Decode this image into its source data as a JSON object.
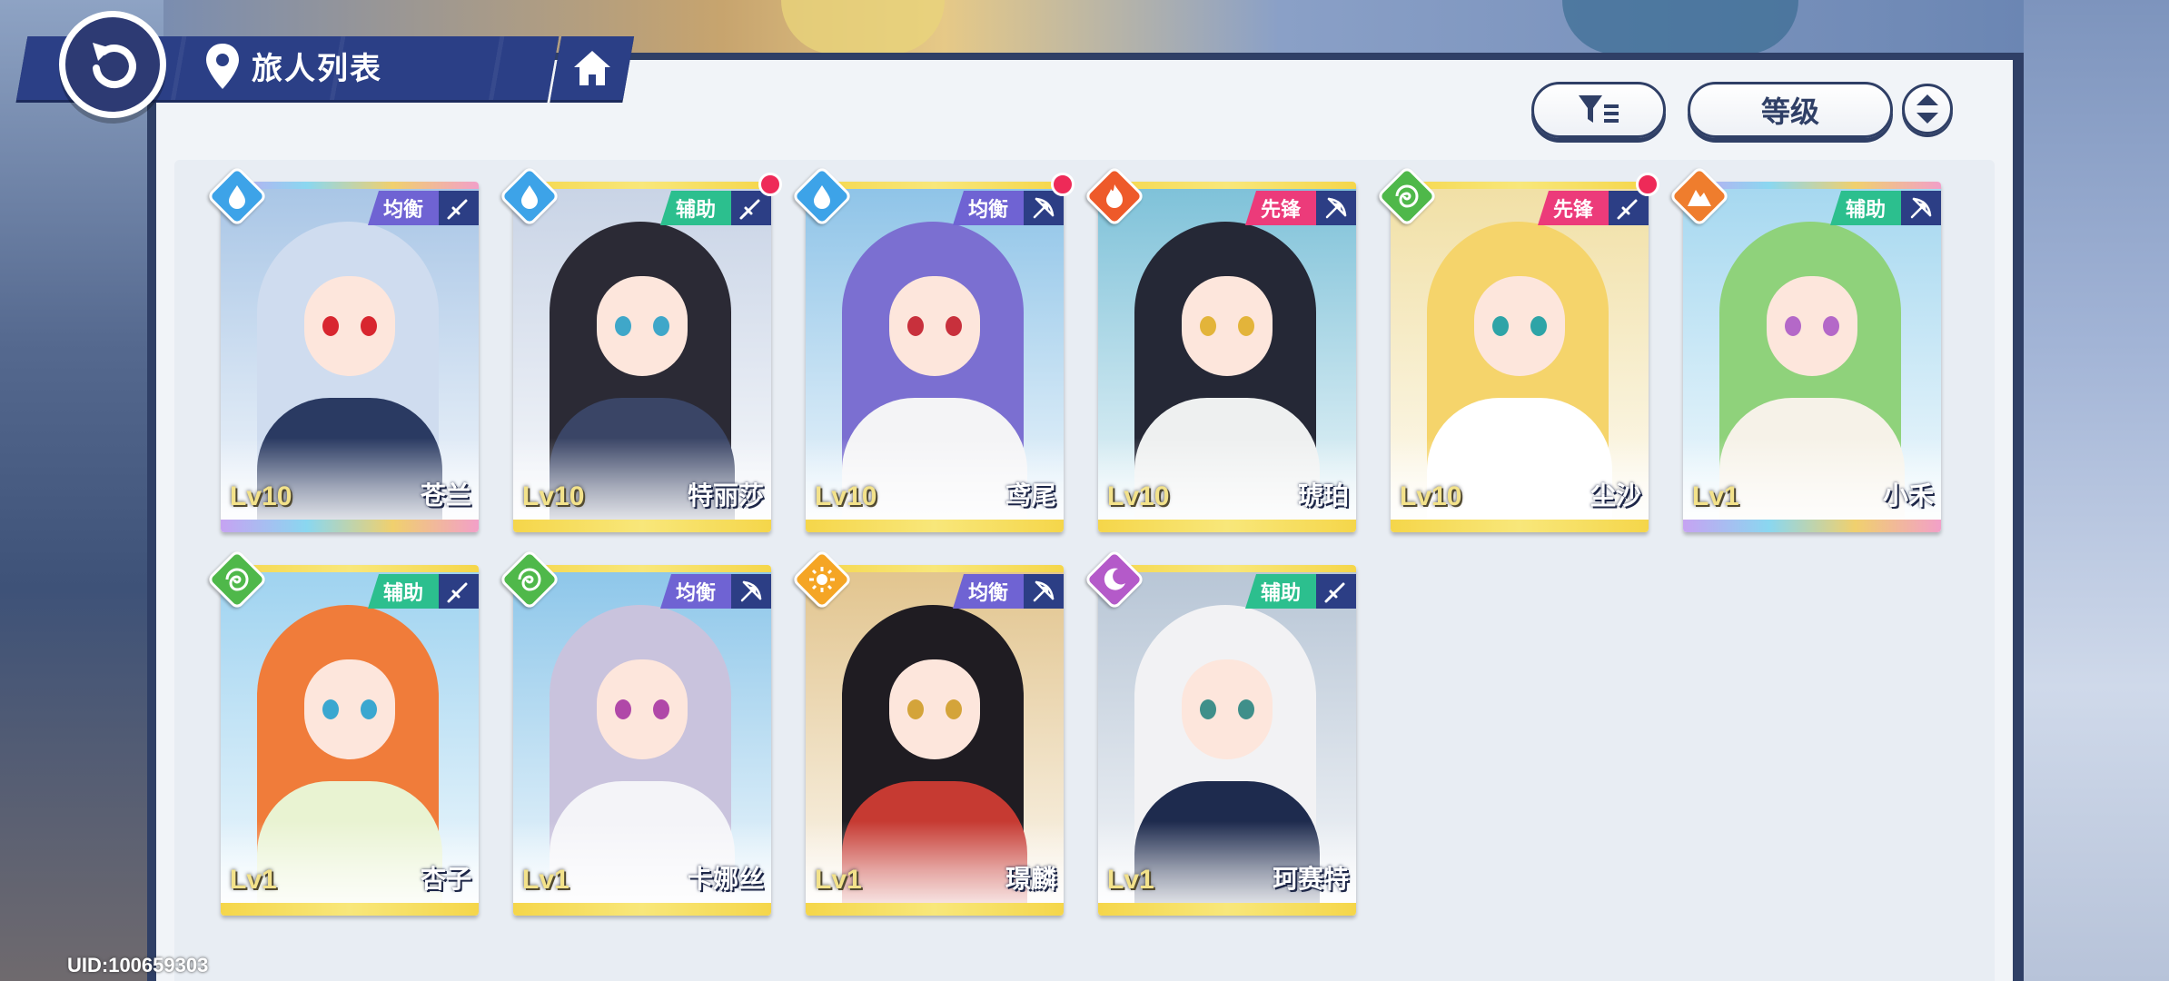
{
  "header": {
    "title": "旅人列表"
  },
  "toolbar": {
    "sort_label": "等级"
  },
  "footer": {
    "uid": "UID:100659303"
  },
  "colors": {
    "panel_border": "#2f3f66",
    "header_blue": "#2b3f86",
    "role_balance": "#6f63d3",
    "role_support": "#2cbf8e",
    "role_vanguard": "#ec3b7a",
    "elem_water": "#3da3e8",
    "elem_fire": "#ee5a2a",
    "elem_wind": "#4fb84a",
    "elem_earth": "#ef7d2d",
    "elem_light": "#f5a524",
    "elem_dark": "#b45ac9",
    "unread_dot": "#ee2a58"
  },
  "characters": [
    {
      "name": "苍兰",
      "level": "Lv10",
      "role": "均衡",
      "element": "water",
      "weapon": "sword",
      "rarity": "rainbow",
      "new": false
    },
    {
      "name": "特丽莎",
      "level": "Lv10",
      "role": "辅助",
      "element": "water",
      "weapon": "sword",
      "rarity": "gold",
      "new": true
    },
    {
      "name": "鸢尾",
      "level": "Lv10",
      "role": "均衡",
      "element": "water",
      "weapon": "bow",
      "rarity": "gold",
      "new": true
    },
    {
      "name": "琥珀",
      "level": "Lv10",
      "role": "先锋",
      "element": "fire",
      "weapon": "bow",
      "rarity": "gold",
      "new": false
    },
    {
      "name": "尘沙",
      "level": "Lv10",
      "role": "先锋",
      "element": "wind",
      "weapon": "sword",
      "rarity": "gold",
      "new": true
    },
    {
      "name": "小禾",
      "level": "Lv1",
      "role": "辅助",
      "element": "earth",
      "weapon": "bow",
      "rarity": "rainbow",
      "new": false
    },
    {
      "name": "杏子",
      "level": "Lv1",
      "role": "辅助",
      "element": "wind",
      "weapon": "sword",
      "rarity": "gold",
      "new": false
    },
    {
      "name": "卡娜丝",
      "level": "Lv1",
      "role": "均衡",
      "element": "wind",
      "weapon": "bow",
      "rarity": "gold",
      "new": false
    },
    {
      "name": "璟麟",
      "level": "Lv1",
      "role": "均衡",
      "element": "light",
      "weapon": "bow",
      "rarity": "gold",
      "new": false
    },
    {
      "name": "珂赛特",
      "level": "Lv1",
      "role": "辅助",
      "element": "dark",
      "weapon": "sword",
      "rarity": "gold",
      "new": false
    }
  ]
}
